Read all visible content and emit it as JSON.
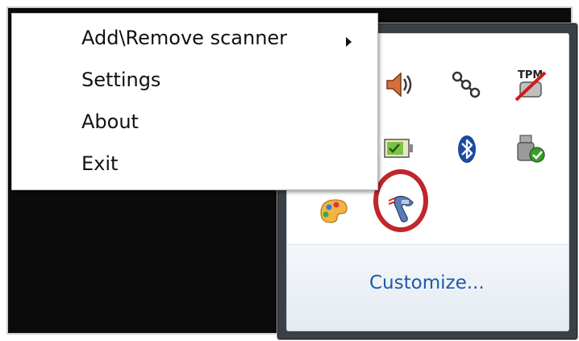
{
  "context_menu": {
    "items": [
      {
        "label": "Add\\Remove scanner",
        "has_submenu": true
      },
      {
        "label": "Settings",
        "has_submenu": false
      },
      {
        "label": "About",
        "has_submenu": false
      },
      {
        "label": "Exit",
        "has_submenu": false
      }
    ]
  },
  "tray_overflow": {
    "icons": [
      "speaker-volume-icon",
      "network-connections-icon",
      "tpm-disabled-icon",
      "battery-meter-icon",
      "bluetooth-icon",
      "safely-remove-hardware-icon",
      "paint-palette-icon",
      "barcode-scanner-icon"
    ],
    "tpm_label": "TPM",
    "customize_label": "Customize..."
  },
  "colors": {
    "highlight_ring": "#c0262c",
    "link": "#1d5aa8",
    "bluetooth": "#1b4aa0"
  }
}
